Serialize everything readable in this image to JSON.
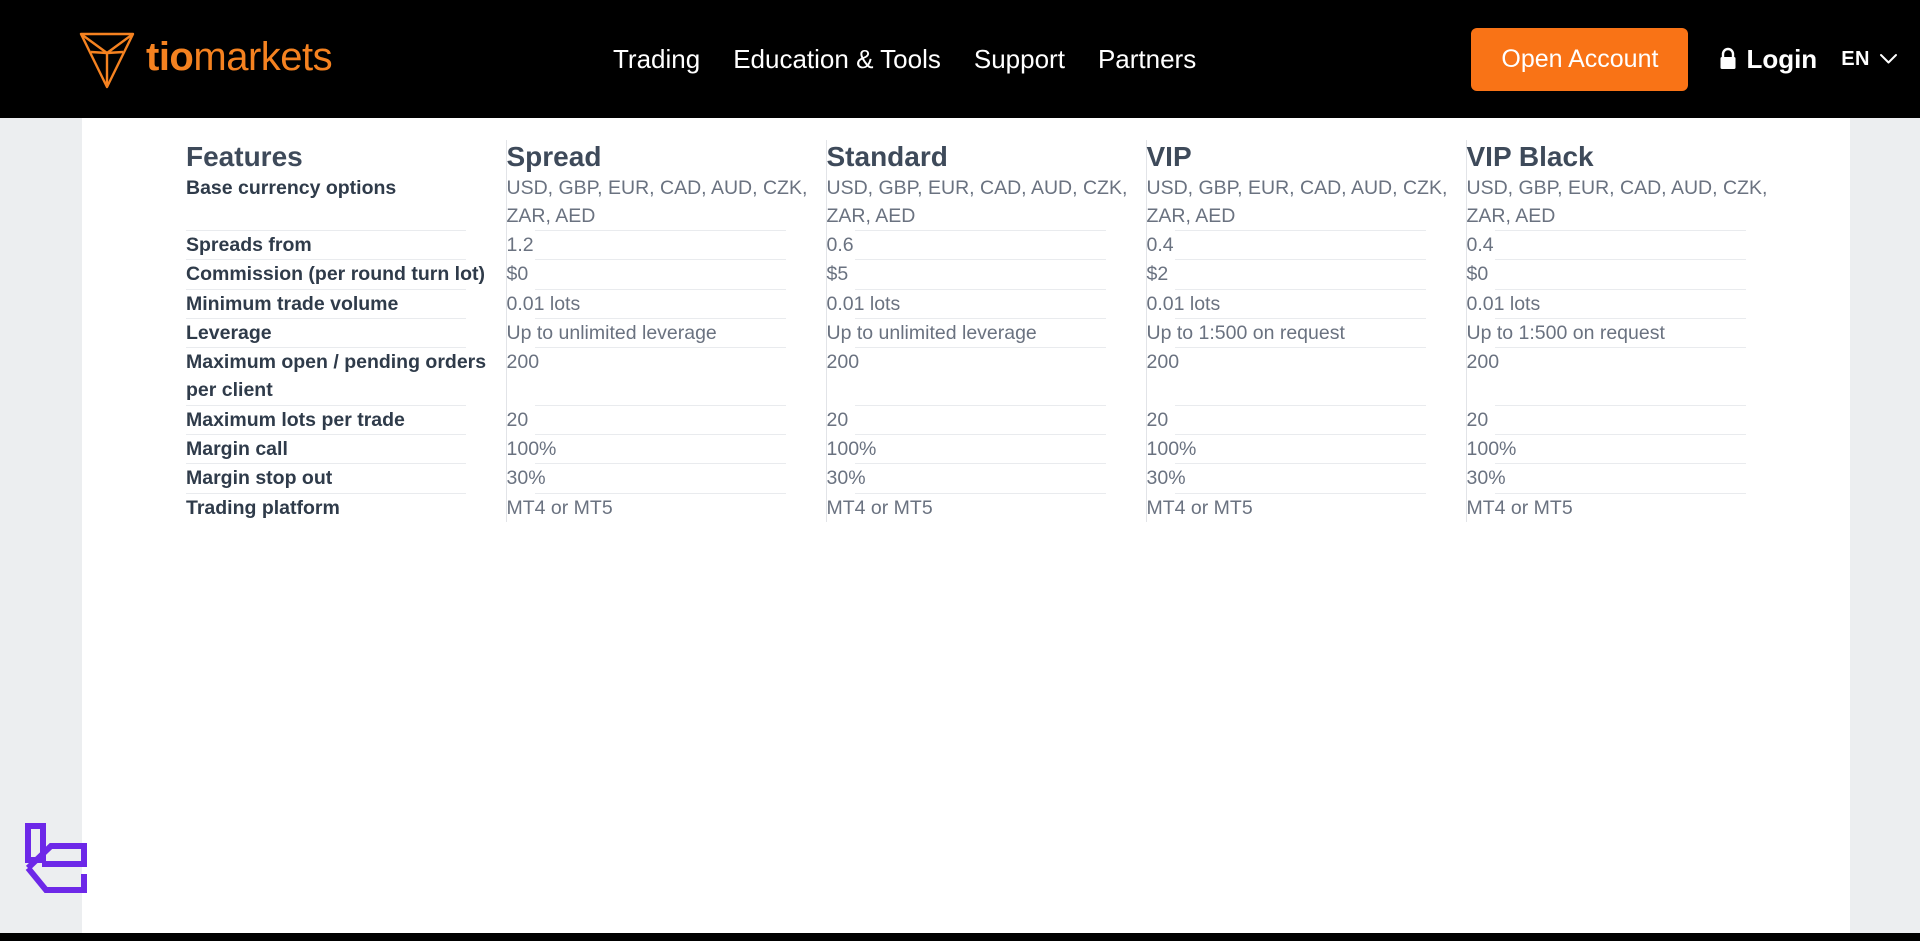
{
  "header": {
    "logo": {
      "icon": "tiomarkets-triangle-logo",
      "word_bold": "tio",
      "word_light": "markets"
    },
    "nav": [
      {
        "label": "Trading"
      },
      {
        "label": "Education & Tools"
      },
      {
        "label": "Support"
      },
      {
        "label": "Partners"
      }
    ],
    "open_account_label": "Open Account",
    "login_label": "Login",
    "login_icon": "lock-icon",
    "language": "EN",
    "language_chevron_icon": "chevron-down-icon",
    "accent_color": "#F97316",
    "logo_color": "#F58220",
    "background_color": "#000000"
  },
  "table": {
    "columns": [
      "Features",
      "Spread",
      "Standard",
      "VIP",
      "VIP Black"
    ],
    "rows": [
      {
        "label": "Base currency options",
        "values": [
          "USD, GBP, EUR, CAD, AUD, CZK, ZAR, AED",
          "USD, GBP, EUR, CAD, AUD, CZK, ZAR, AED",
          "USD, GBP, EUR, CAD, AUD, CZK, ZAR, AED",
          "USD, GBP, EUR, CAD, AUD, CZK, ZAR, AED"
        ]
      },
      {
        "label": "Spreads from",
        "values": [
          "1.2",
          "0.6",
          "0.4",
          "0.4"
        ]
      },
      {
        "label": "Commission (per round turn lot)",
        "values": [
          "$0",
          "$5",
          "$2",
          "$0"
        ]
      },
      {
        "label": "Minimum trade volume",
        "values": [
          "0.01 lots",
          "0.01 lots",
          "0.01 lots",
          "0.01 lots"
        ]
      },
      {
        "label": "Leverage",
        "values": [
          "Up to unlimited leverage",
          "Up to unlimited leverage",
          "Up to 1:500 on request",
          "Up to 1:500 on request"
        ]
      },
      {
        "label": "Maximum open / pending orders per client",
        "values": [
          "200",
          "200",
          "200",
          "200"
        ]
      },
      {
        "label": "Maximum lots per trade",
        "values": [
          "20",
          "20",
          "20",
          "20"
        ]
      },
      {
        "label": "Margin call",
        "values": [
          "100%",
          "100%",
          "100%",
          "100%"
        ]
      },
      {
        "label": "Margin stop out",
        "values": [
          "30%",
          "30%",
          "30%",
          "30%"
        ]
      },
      {
        "label": "Trading platform",
        "values": [
          "MT4 or MT5",
          "MT4 or MT5",
          "MT4 or MT5",
          "MT4 or MT5"
        ]
      }
    ]
  },
  "watermark": {
    "icon": "purple-e-logo-watermark",
    "color": "#6D28E8"
  }
}
